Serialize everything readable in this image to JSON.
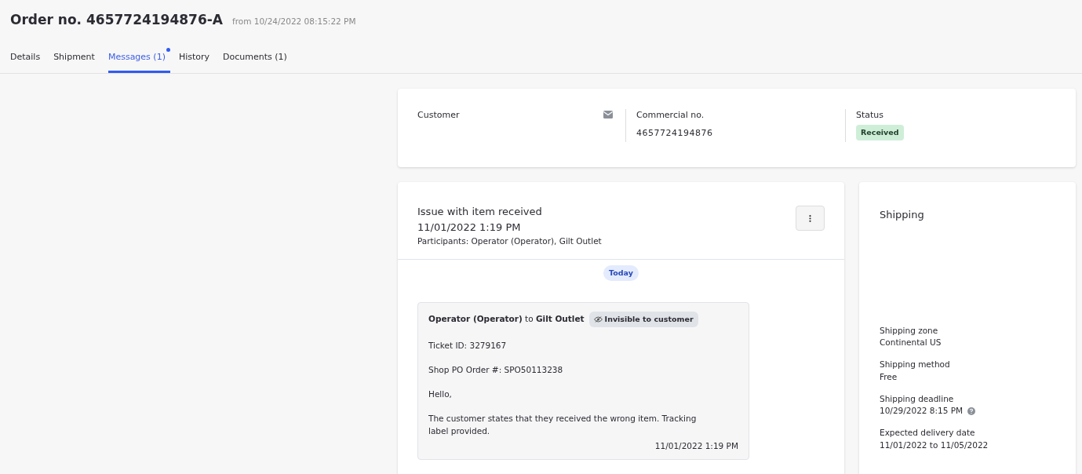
{
  "header": {
    "title": "Order no. 4657724194876-A",
    "subtitle": "from 10/24/2022 08:15:22 PM"
  },
  "tabs": [
    {
      "label": "Details",
      "selected": false,
      "unread": false
    },
    {
      "label": "Shipment",
      "selected": false,
      "unread": false
    },
    {
      "label": "Messages (1)",
      "selected": true,
      "unread": true
    },
    {
      "label": "History",
      "selected": false,
      "unread": false
    },
    {
      "label": "Documents (1)",
      "selected": false,
      "unread": false
    }
  ],
  "summary": {
    "customer_label": "Customer",
    "commercial_label": "Commercial no.",
    "commercial_value": "4657724194876",
    "status_label": "Status",
    "status": "Received"
  },
  "thread": {
    "title": "Issue with item received",
    "date": "11/01/2022 1:19 PM",
    "participants": "Participants: Operator (Operator), Gilt Outlet",
    "day_label": "Today",
    "message": {
      "from_to": "**Operator (Operator)** to **Gilt Outlet**",
      "visibility": "Invisible to customer",
      "paragraphs": [
        "Ticket ID: 3279167",
        "Shop PO Order #: SPO50113238",
        "Hello,",
        "The customer states that they received the wrong item. Tracking label provided."
      ],
      "time": "11/01/2022 1:19 PM"
    }
  },
  "shipping": {
    "title": "Shipping",
    "fields": [
      {
        "label": "Shipping zone",
        "value": "Continental US"
      },
      {
        "label": "Shipping method",
        "value": "Free"
      },
      {
        "label": "Shipping deadline",
        "value": "10/29/2022 8:15 PM",
        "help": true
      },
      {
        "label": "Expected delivery date",
        "value": "11/01/2022 to 11/05/2022"
      }
    ]
  }
}
